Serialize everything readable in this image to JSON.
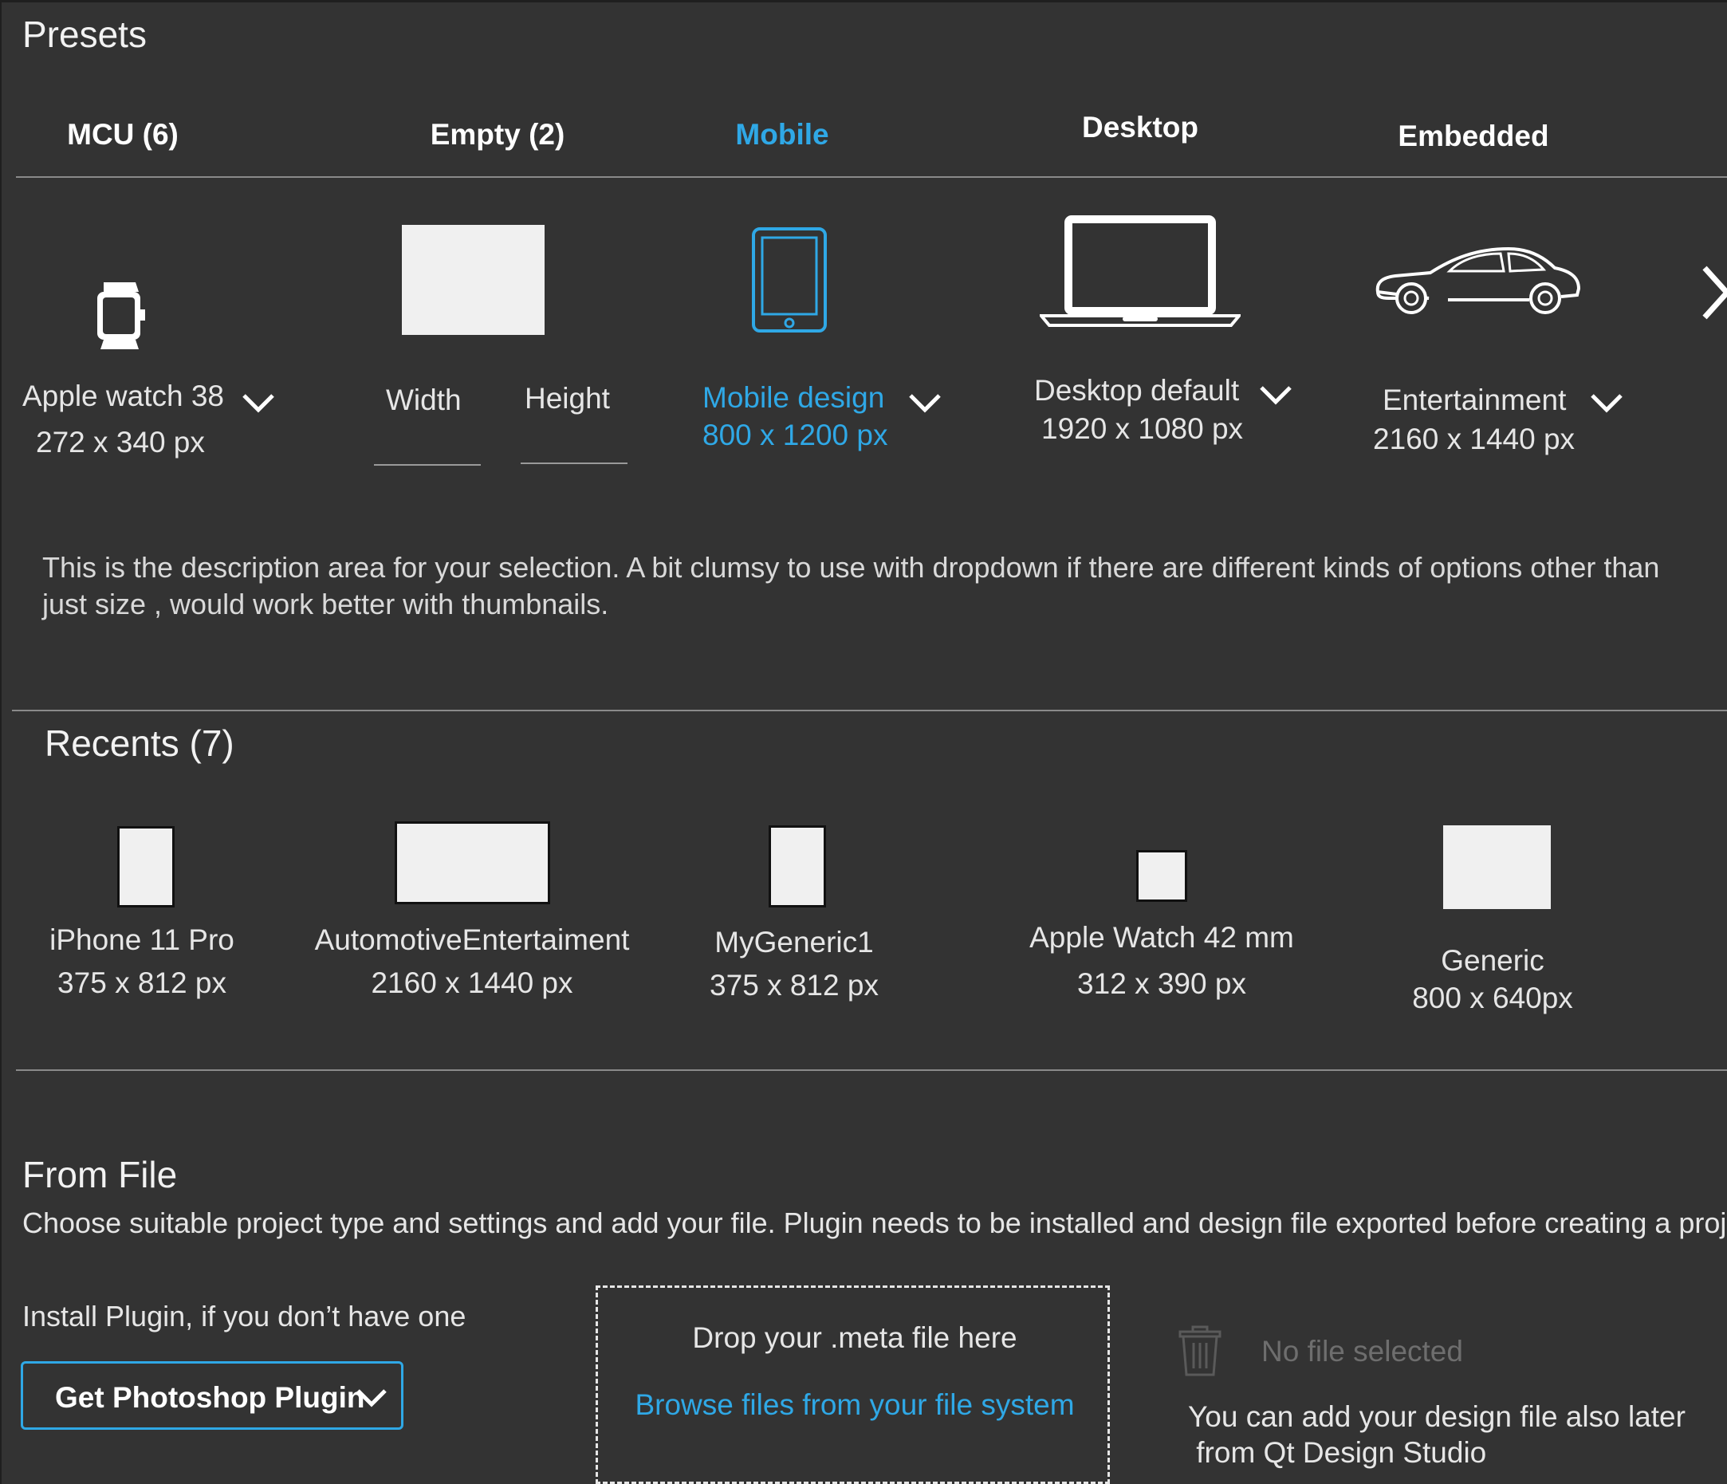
{
  "presets": {
    "title": "Presets",
    "tabs": [
      {
        "label": "MCU (6)",
        "active": false
      },
      {
        "label": "Empty (2)",
        "active": false
      },
      {
        "label": "Mobile",
        "active": true
      },
      {
        "label": "Desktop",
        "active": false
      },
      {
        "label": "Embedded",
        "active": false
      }
    ],
    "items": [
      {
        "name": "Apple watch 38",
        "size": "272 x 340 px",
        "icon": "watch-icon"
      },
      {
        "width_label": "Width",
        "height_label": "Height",
        "icon": "blank-canvas-icon"
      },
      {
        "name": "Mobile design",
        "size": "800 x 1200 px",
        "icon": "tablet-icon",
        "selected": true
      },
      {
        "name": "Desktop  default",
        "size": "1920 x 1080 px",
        "icon": "laptop-icon"
      },
      {
        "name": "Entertainment",
        "size": "2160 x 1440 px",
        "icon": "car-icon"
      }
    ],
    "description": "This is the description area  for your selection. A bit clumsy to use with dropdown if there  are different kinds of options other than just size , would work  better with thumbnails."
  },
  "recents": {
    "title": "Recents  (7)",
    "items": [
      {
        "name": "iPhone 11 Pro",
        "size": "375 x 812 px"
      },
      {
        "name": "AutomotiveEntertaiment",
        "size": "2160 x 1440 px"
      },
      {
        "name": "MyGeneric1",
        "size": "375 x 812 px"
      },
      {
        "name": "Apple Watch 42 mm",
        "size": "312 x 390 px"
      },
      {
        "name": "Generic",
        "size": "800 x 640px"
      }
    ]
  },
  "from_file": {
    "title": "From File",
    "description": "Choose suitable project type and settings and add your file. Plugin needs to be installed and design file exported before creating a project.",
    "install_label": "Install Plugin, if you don’t have one",
    "plugin_button": "Get  Photoshop Plugin",
    "drop_text": "Drop your .meta file here",
    "browse_link": "Browse files from your file system",
    "no_file": "No file selected",
    "later_line1": "You can add your design file also later",
    "later_line2": " from Qt Design Studio"
  },
  "colors": {
    "accent": "#2fa8e6",
    "background": "#333333",
    "text": "#e6e6e6"
  }
}
